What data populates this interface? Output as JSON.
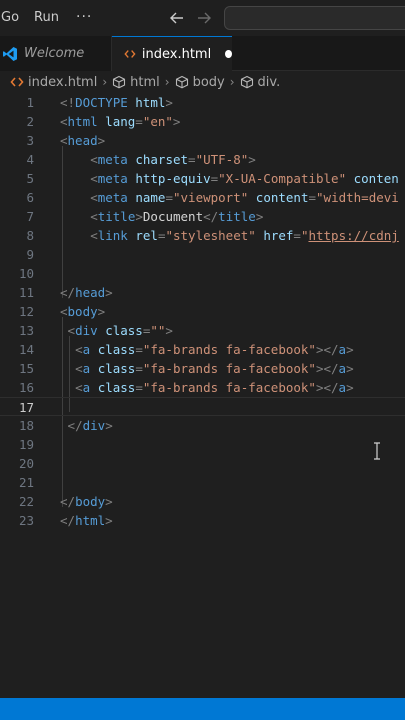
{
  "menu": {
    "go": "Go",
    "run": "Run",
    "more": "···"
  },
  "tabs": [
    {
      "label": "Welcome"
    },
    {
      "label": "index.html"
    }
  ],
  "breadcrumb": [
    "index.html",
    "html",
    "body",
    "div."
  ],
  "editor": {
    "current_line": 17,
    "lines": [
      {
        "n": "1",
        "indent": 0,
        "tokens": [
          [
            "punc",
            "<!"
          ],
          [
            "tag",
            "DOCTYPE"
          ],
          [
            "text",
            " "
          ],
          [
            "attr",
            "html"
          ],
          [
            "punc",
            ">"
          ]
        ]
      },
      {
        "n": "2",
        "indent": 0,
        "tokens": [
          [
            "punc",
            "<"
          ],
          [
            "tag",
            "html"
          ],
          [
            "text",
            " "
          ],
          [
            "attr",
            "lang"
          ],
          [
            "punc",
            "="
          ],
          [
            "str",
            "\"en\""
          ],
          [
            "punc",
            ">"
          ]
        ]
      },
      {
        "n": "3",
        "indent": 0,
        "tokens": [
          [
            "punc",
            "<"
          ],
          [
            "tag",
            "head"
          ],
          [
            "punc",
            ">"
          ]
        ]
      },
      {
        "n": "4",
        "indent": 4,
        "tokens": [
          [
            "punc",
            "<"
          ],
          [
            "tag",
            "meta"
          ],
          [
            "text",
            " "
          ],
          [
            "attr",
            "charset"
          ],
          [
            "punc",
            "="
          ],
          [
            "str",
            "\"UTF-8\""
          ],
          [
            "punc",
            ">"
          ]
        ]
      },
      {
        "n": "5",
        "indent": 4,
        "tokens": [
          [
            "punc",
            "<"
          ],
          [
            "tag",
            "meta"
          ],
          [
            "text",
            " "
          ],
          [
            "attr",
            "http-equiv"
          ],
          [
            "punc",
            "="
          ],
          [
            "str",
            "\"X-UA-Compatible\""
          ],
          [
            "text",
            " "
          ],
          [
            "attr",
            "conten"
          ]
        ]
      },
      {
        "n": "6",
        "indent": 4,
        "tokens": [
          [
            "punc",
            "<"
          ],
          [
            "tag",
            "meta"
          ],
          [
            "text",
            " "
          ],
          [
            "attr",
            "name"
          ],
          [
            "punc",
            "="
          ],
          [
            "str",
            "\"viewport\""
          ],
          [
            "text",
            " "
          ],
          [
            "attr",
            "content"
          ],
          [
            "punc",
            "="
          ],
          [
            "str",
            "\"width=devi"
          ]
        ]
      },
      {
        "n": "7",
        "indent": 4,
        "tokens": [
          [
            "punc",
            "<"
          ],
          [
            "tag",
            "title"
          ],
          [
            "punc",
            ">"
          ],
          [
            "text",
            "Document"
          ],
          [
            "punc",
            "</"
          ],
          [
            "tag",
            "title"
          ],
          [
            "punc",
            ">"
          ]
        ]
      },
      {
        "n": "8",
        "indent": 4,
        "tokens": [
          [
            "punc",
            "<"
          ],
          [
            "tag",
            "link"
          ],
          [
            "text",
            " "
          ],
          [
            "attr",
            "rel"
          ],
          [
            "punc",
            "="
          ],
          [
            "str",
            "\"stylesheet\""
          ],
          [
            "text",
            " "
          ],
          [
            "attr",
            "href"
          ],
          [
            "punc",
            "="
          ],
          [
            "str",
            "\""
          ],
          [
            "url",
            "https://cdnj"
          ]
        ]
      },
      {
        "n": "9",
        "indent": 0,
        "tokens": []
      },
      {
        "n": "10",
        "indent": 0,
        "tokens": []
      },
      {
        "n": "11",
        "indent": 0,
        "tokens": [
          [
            "punc",
            "</"
          ],
          [
            "tag",
            "head"
          ],
          [
            "punc",
            ">"
          ]
        ]
      },
      {
        "n": "12",
        "indent": 0,
        "tokens": [
          [
            "punc",
            "<"
          ],
          [
            "tag",
            "body"
          ],
          [
            "punc",
            ">"
          ]
        ]
      },
      {
        "n": "13",
        "indent": 1,
        "tokens": [
          [
            "punc",
            "<"
          ],
          [
            "tag",
            "div"
          ],
          [
            "text",
            " "
          ],
          [
            "attr",
            "class"
          ],
          [
            "punc",
            "="
          ],
          [
            "str",
            "\"\""
          ],
          [
            "punc",
            ">"
          ]
        ]
      },
      {
        "n": "14",
        "indent": 2,
        "tokens": [
          [
            "punc",
            "<"
          ],
          [
            "tag",
            "a"
          ],
          [
            "text",
            " "
          ],
          [
            "attr",
            "class"
          ],
          [
            "punc",
            "="
          ],
          [
            "str",
            "\"fa-brands fa-facebook\""
          ],
          [
            "punc",
            "></"
          ],
          [
            "tag",
            "a"
          ],
          [
            "punc",
            ">"
          ]
        ]
      },
      {
        "n": "15",
        "indent": 2,
        "tokens": [
          [
            "punc",
            "<"
          ],
          [
            "tag",
            "a"
          ],
          [
            "text",
            " "
          ],
          [
            "attr",
            "class"
          ],
          [
            "punc",
            "="
          ],
          [
            "str",
            "\"fa-brands fa-facebook\""
          ],
          [
            "punc",
            "></"
          ],
          [
            "tag",
            "a"
          ],
          [
            "punc",
            ">"
          ]
        ]
      },
      {
        "n": "16",
        "indent": 2,
        "tokens": [
          [
            "punc",
            "<"
          ],
          [
            "tag",
            "a"
          ],
          [
            "text",
            " "
          ],
          [
            "attr",
            "class"
          ],
          [
            "punc",
            "="
          ],
          [
            "str",
            "\"fa-brands fa-facebook\""
          ],
          [
            "punc",
            "></"
          ],
          [
            "tag",
            "a"
          ],
          [
            "punc",
            ">"
          ]
        ]
      },
      {
        "n": "17",
        "indent": 0,
        "tokens": []
      },
      {
        "n": "18",
        "indent": 1,
        "tokens": [
          [
            "punc",
            "</"
          ],
          [
            "tag",
            "div"
          ],
          [
            "punc",
            ">"
          ]
        ]
      },
      {
        "n": "19",
        "indent": 0,
        "tokens": []
      },
      {
        "n": "20",
        "indent": 0,
        "tokens": []
      },
      {
        "n": "21",
        "indent": 0,
        "tokens": []
      },
      {
        "n": "22",
        "indent": 0,
        "tokens": [
          [
            "punc",
            "</"
          ],
          [
            "tag",
            "body"
          ],
          [
            "punc",
            ">"
          ]
        ]
      },
      {
        "n": "23",
        "indent": 0,
        "tokens": [
          [
            "punc",
            "</"
          ],
          [
            "tag",
            "html"
          ],
          [
            "punc",
            ">"
          ]
        ]
      }
    ]
  },
  "colors": {
    "accent": "#0078d4",
    "tag": "#569cd6",
    "attribute": "#9cdcfe",
    "string": "#ce9178",
    "punctuation": "#808080"
  }
}
